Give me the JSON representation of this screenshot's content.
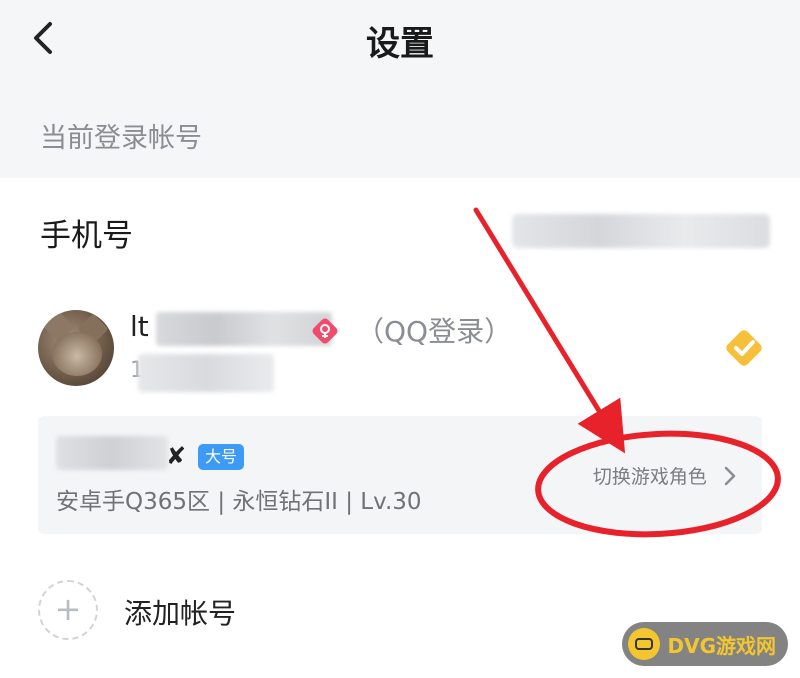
{
  "header": {
    "title": "设置",
    "back_icon": "chevron-left-icon"
  },
  "section": {
    "label": "当前登录帐号"
  },
  "phone": {
    "label": "手机号"
  },
  "account": {
    "nickname_prefix": "lt",
    "gender_icon": "female-icon",
    "login_type": "（QQ登录）",
    "sub_prefix": "1",
    "selected_icon": "check-badge-icon",
    "selected_color": "#f7c03a"
  },
  "role": {
    "name_suffix": "✘",
    "badge": "大号",
    "info": "安卓手Q365区 | 永恒钻石II | Lv.30",
    "switch_label": "切换游戏角色"
  },
  "add_account": {
    "label": "添加帐号"
  },
  "annotation": {
    "color": "#e8222a"
  },
  "watermark": {
    "text": "DVG游戏网"
  }
}
